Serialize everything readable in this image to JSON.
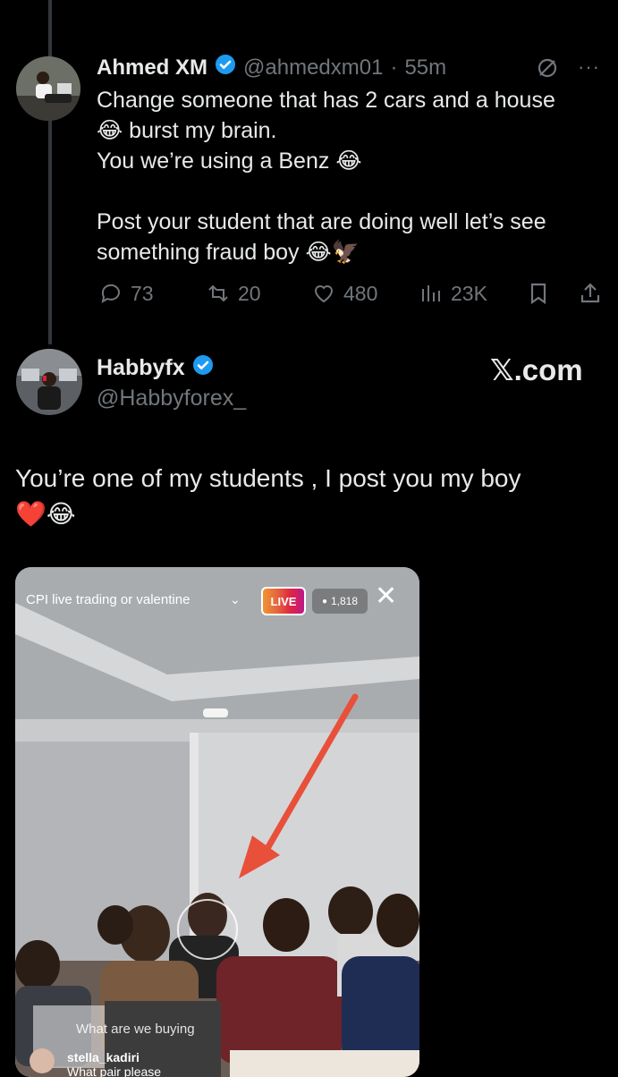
{
  "quoted_tweet": {
    "author_name": "Ahmed XM",
    "handle": "@ahmedxm01",
    "separator": "·",
    "time": "55m",
    "lines": [
      "Change someone that has 2 cars and a house",
      "burst my brain.",
      "You we’re using a Benz",
      "",
      "Post your student that are doing well let’s see",
      "something fraud boy"
    ],
    "emojis": {
      "laugh": "😂",
      "eagle": "🦅"
    },
    "actions": {
      "replies": "73",
      "reposts": "20",
      "likes": "480",
      "views": "23K"
    }
  },
  "main_tweet": {
    "author_name": "Habbyfx",
    "handle": "@Habbyforex_",
    "watermark": "𝕏.com",
    "text_line1": "You’re one of my students ,  I post you my boy",
    "emojis": {
      "heart": "❤️",
      "laugh": "😂"
    }
  },
  "live_screenshot": {
    "title": "CPI  live trading or valentine",
    "live_badge": "LIVE",
    "viewer_count": "1,818",
    "close": "✕",
    "comments": [
      {
        "user": "",
        "text": "What are we buying"
      },
      {
        "user": "stella_kadiri",
        "text": "What pair please"
      }
    ]
  },
  "colors": {
    "background": "#000000",
    "text": "#e7e9ea",
    "muted": "#71767b",
    "verified": "#1d9bf0",
    "arrow": "#e8503a"
  }
}
